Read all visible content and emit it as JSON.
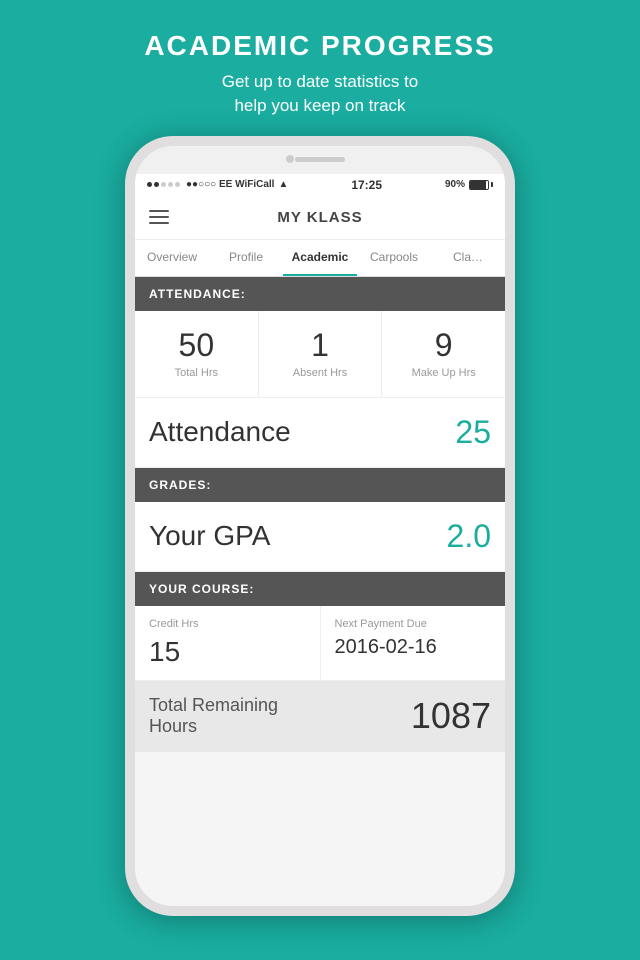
{
  "page": {
    "bg_color": "#1aada0",
    "header": {
      "title": "ACADEMIC PROGRESS",
      "subtitle": "Get up to date statistics to\nhelp you keep on track"
    }
  },
  "phone": {
    "status_bar": {
      "carrier": "●●○○○ EE WiFiCall",
      "wifi": "WiFi",
      "time": "17:25",
      "battery_pct": "90%",
      "battery_icon": "battery"
    },
    "nav": {
      "menu_icon": "☰",
      "title": "MY KLASS"
    },
    "tabs": [
      {
        "label": "Overview",
        "active": false
      },
      {
        "label": "Profile",
        "active": false
      },
      {
        "label": "Academic",
        "active": true
      },
      {
        "label": "Carpools",
        "active": false
      },
      {
        "label": "Cla...",
        "active": false
      }
    ],
    "sections": {
      "attendance_header": "ATTENDANCE:",
      "attendance_stats": [
        {
          "value": "50",
          "label": "Total Hrs"
        },
        {
          "value": "1",
          "label": "Absent Hrs"
        },
        {
          "value": "9",
          "label": "Make Up Hrs"
        }
      ],
      "attendance_row": {
        "label": "Attendance",
        "value": "25"
      },
      "grades_header": "GRADES:",
      "gpa_row": {
        "label": "Your GPA",
        "value": "2.0"
      },
      "course_header": "YOUR COURSE:",
      "course_cells": [
        {
          "label": "Credit Hrs",
          "value": "15"
        },
        {
          "label": "Next Payment Due",
          "value": "2016-02-16"
        }
      ],
      "total_remaining": {
        "label": "Total Remaining\nHours",
        "value": "1087"
      }
    }
  }
}
